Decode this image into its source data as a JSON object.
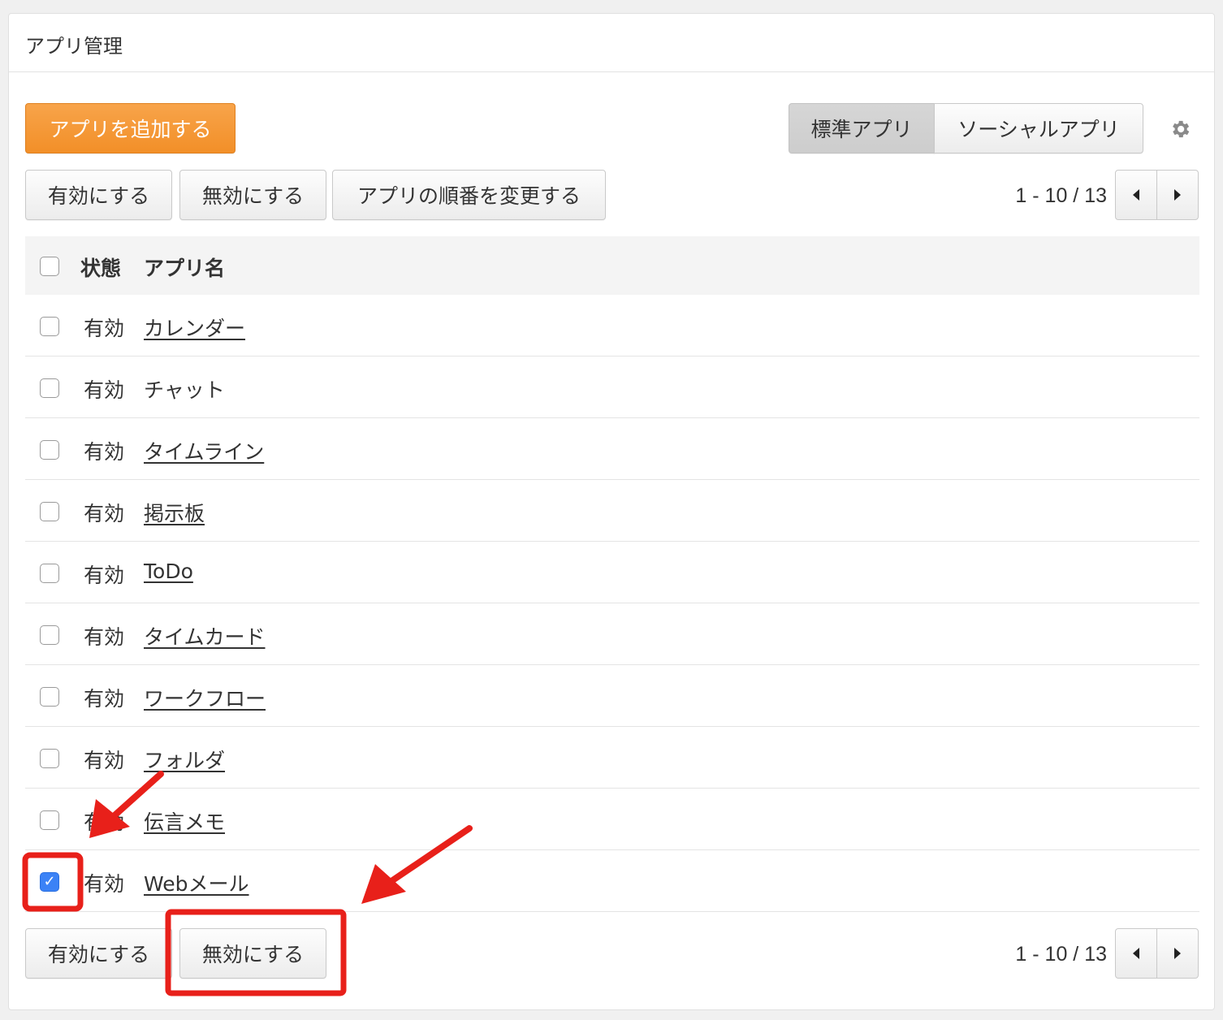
{
  "page": {
    "title": "アプリ管理"
  },
  "toolbar": {
    "add_app": "アプリを追加する",
    "tab_standard": "標準アプリ",
    "tab_social": "ソーシャルアプリ",
    "enable": "有効にする",
    "disable": "無効にする",
    "reorder": "アプリの順番を変更する"
  },
  "pagination": {
    "range": "1 - 10 / 13"
  },
  "table": {
    "columns": {
      "status": "状態",
      "name": "アプリ名"
    },
    "rows": [
      {
        "status": "有効",
        "name": "カレンダー",
        "link": true,
        "checked": false
      },
      {
        "status": "有効",
        "name": "チャット",
        "link": false,
        "checked": false
      },
      {
        "status": "有効",
        "name": "タイムライン",
        "link": true,
        "checked": false
      },
      {
        "status": "有効",
        "name": "掲示板",
        "link": true,
        "checked": false
      },
      {
        "status": "有効",
        "name": "ToDo",
        "link": true,
        "checked": false
      },
      {
        "status": "有効",
        "name": "タイムカード",
        "link": true,
        "checked": false
      },
      {
        "status": "有効",
        "name": "ワークフロー",
        "link": true,
        "checked": false
      },
      {
        "status": "有効",
        "name": "フォルダ",
        "link": true,
        "checked": false
      },
      {
        "status": "有効",
        "name": "伝言メモ",
        "link": true,
        "checked": false
      },
      {
        "status": "有効",
        "name": "Webメール",
        "link": true,
        "checked": true
      }
    ]
  },
  "footer": {
    "enable": "有効にする",
    "disable": "無効にする"
  },
  "colors": {
    "accent_orange": "#f39a38",
    "annotation_red": "#e8201a",
    "checkbox_blue": "#3b82f6"
  }
}
